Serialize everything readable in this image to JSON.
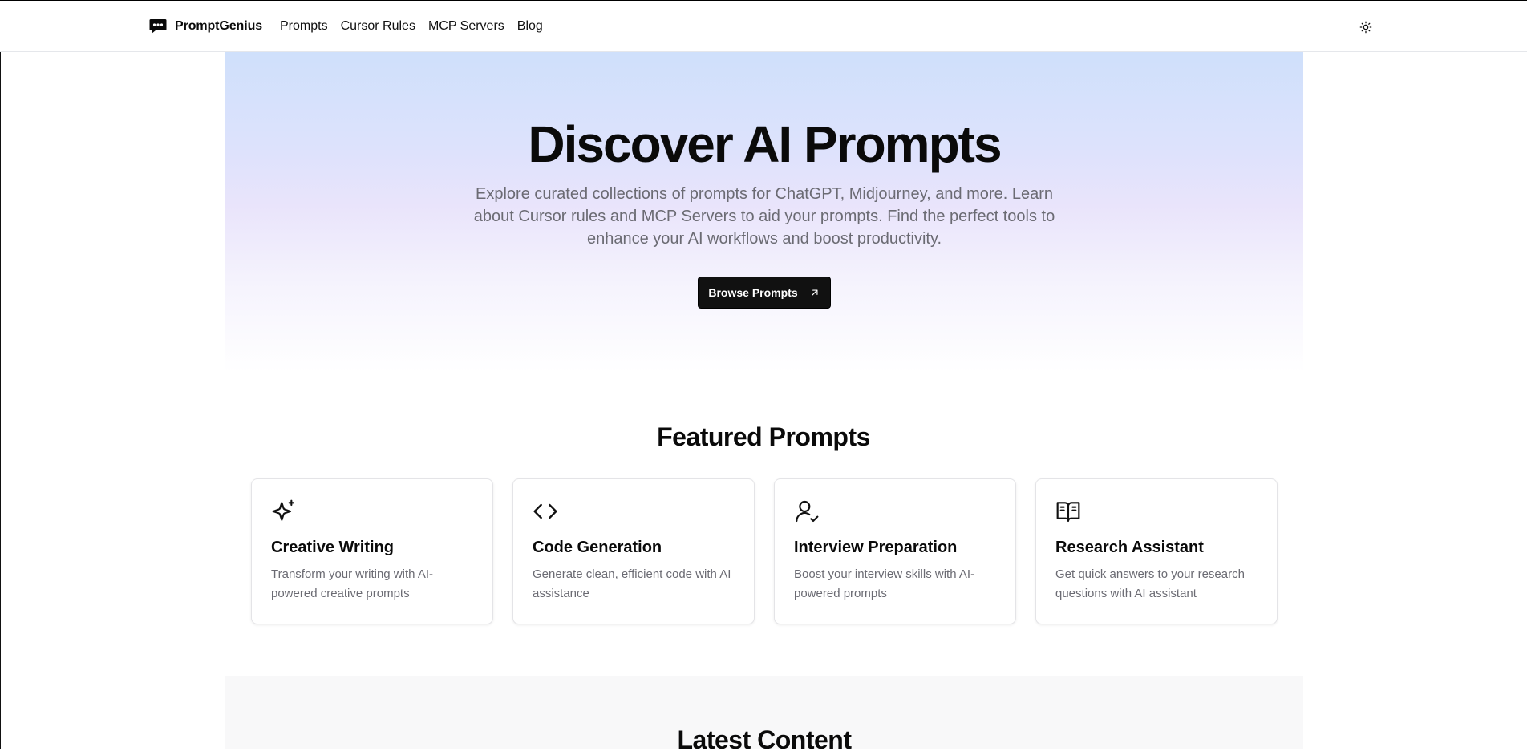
{
  "header": {
    "brand": "PromptGenius",
    "brand_icon": "chat-bubble-icon",
    "nav": [
      "Prompts",
      "Cursor Rules",
      "MCP Servers",
      "Blog"
    ],
    "theme_icon": "sun-icon"
  },
  "hero": {
    "title": "Discover AI Prompts",
    "subtitle": "Explore curated collections of prompts for ChatGPT, Midjourney, and more. Learn about Cursor rules and MCP Servers to aid your prompts. Find the perfect tools to enhance your AI workflows and boost productivity.",
    "cta_label": "Browse Prompts",
    "cta_icon": "arrow-up-right-icon"
  },
  "featured": {
    "title": "Featured Prompts",
    "cards": [
      {
        "icon": "sparkles-icon",
        "title": "Creative Writing",
        "desc": "Transform your writing with AI-powered creative prompts"
      },
      {
        "icon": "code-icon",
        "title": "Code Generation",
        "desc": "Generate clean, efficient code with AI assistance"
      },
      {
        "icon": "user-check-icon",
        "title": "Interview Preparation",
        "desc": "Boost your interview skills with AI-powered prompts"
      },
      {
        "icon": "book-open-icon",
        "title": "Research Assistant",
        "desc": "Get quick answers to your research questions with AI assistant"
      }
    ]
  },
  "latest": {
    "title": "Latest Content"
  },
  "colors": {
    "accent": "#111111",
    "muted_text": "#6b6b73",
    "hero_top": "#cfe0fb",
    "hero_mid": "#e9e4fb"
  }
}
